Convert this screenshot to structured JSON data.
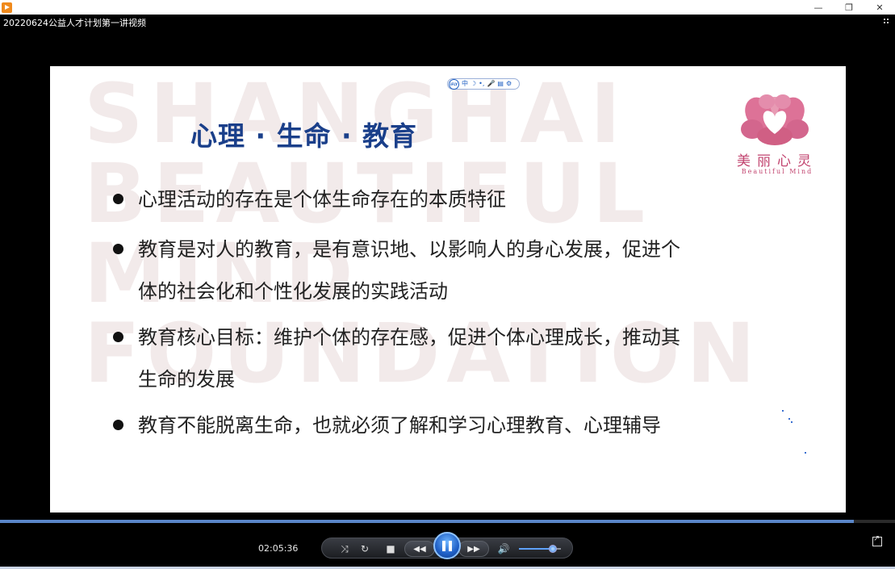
{
  "window": {
    "title": "20220624公益人才计划第一讲视频",
    "icon": "media-player-icon",
    "controls": [
      "minimize-icon",
      "restore-icon",
      "close-icon"
    ]
  },
  "slide": {
    "watermark_lines": [
      "SHANGHAI",
      "BEAUTIFUL",
      "MIND",
      "FOUNDATION"
    ],
    "title": "心理 · 生命 · 教育",
    "logo": {
      "cn": "美丽心灵",
      "en": "Beautiful Mind",
      "color": "#c2446f"
    },
    "ifly_toolbar": {
      "logo": "iFLY",
      "items": [
        "中",
        "☽",
        "•,",
        "🎤",
        "▤",
        "⚙"
      ]
    },
    "bullets": [
      {
        "lines": [
          "心理活动的存在是个体生命存在的本质特征"
        ]
      },
      {
        "lines": [
          "教育是对人的教育，是有意识地、以影响人的身心发展，促进个",
          "体的社会化和个性化发展的实践活动"
        ]
      },
      {
        "lines": [
          "教育核心目标：维护个体的存在感，促进个体心理成长，推动其",
          "生命的发展"
        ]
      },
      {
        "lines": [
          "教育不能脱离生命，也就必须了解和学习心理教育、心理辅导"
        ]
      }
    ],
    "title_color": "#1a3f8a"
  },
  "player": {
    "time": "02:05:36",
    "progress": 0.954,
    "volume": 0.8,
    "accent": "#5a86c8"
  }
}
